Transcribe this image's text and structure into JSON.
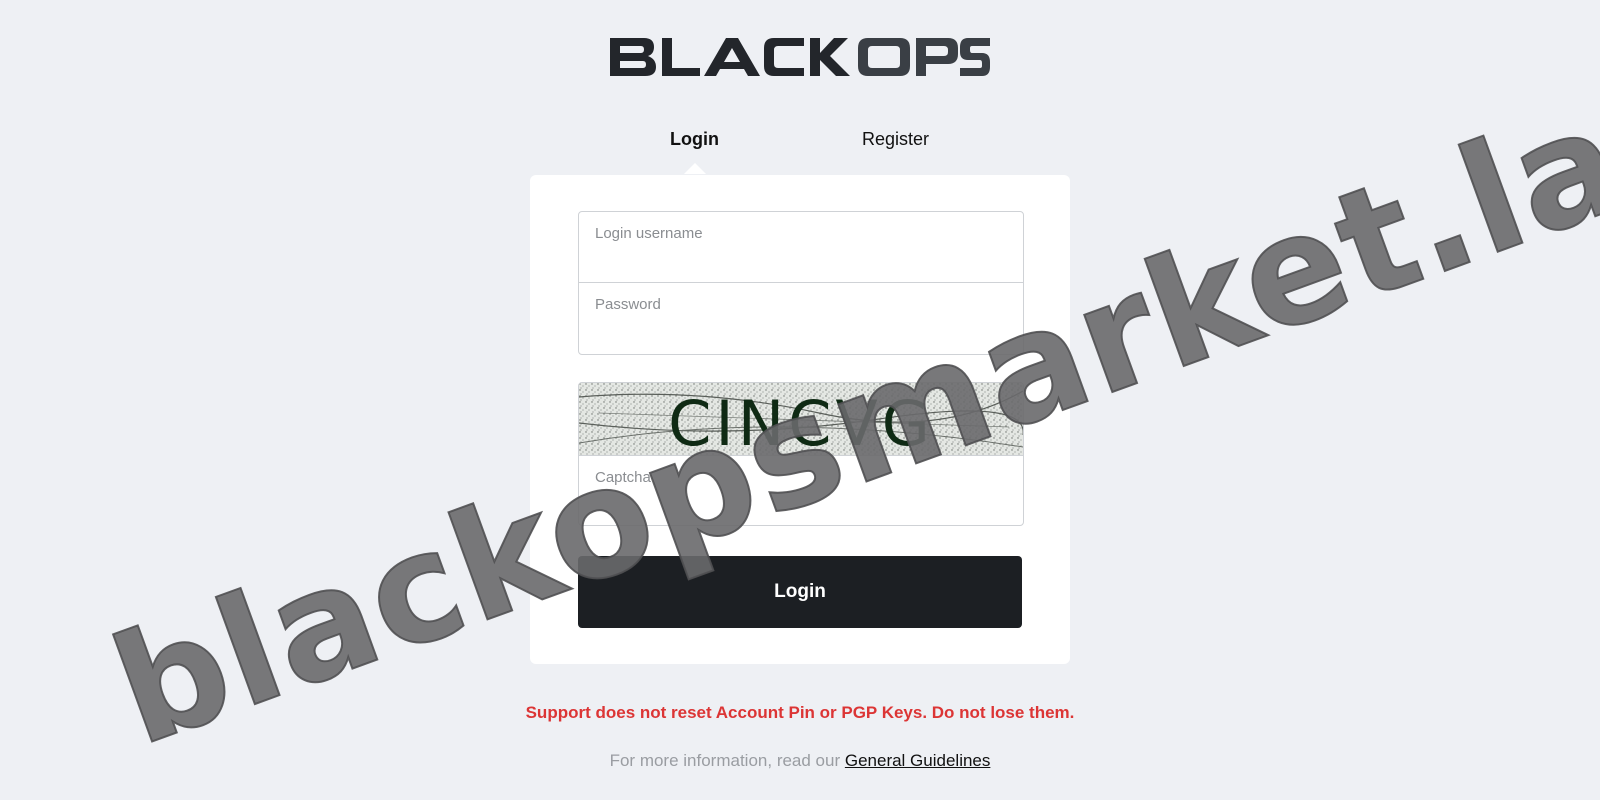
{
  "header": {
    "logo_text": "BLACK OPS",
    "logo_color_primary": "#23262b",
    "logo_color_secondary": "#3a3f45"
  },
  "tabs": [
    {
      "label": "Login",
      "active": true
    },
    {
      "label": "Register",
      "active": false
    }
  ],
  "form": {
    "username": {
      "label": "Login username",
      "value": ""
    },
    "password": {
      "label": "Password",
      "value": ""
    },
    "captcha": {
      "image_text": "CINCVG",
      "label": "Captcha",
      "value": ""
    },
    "submit_label": "Login"
  },
  "notices": {
    "warning": "Support does not reset Account Pin or PGP Keys. Do not lose them.",
    "info_prefix": "For more information, read our ",
    "guidelines_link": "General Guidelines"
  },
  "watermark": {
    "text": "blackopsmarket.lat"
  },
  "colors": {
    "background": "#eef0f4",
    "card": "#ffffff",
    "button": "#1c1f23",
    "warning": "#dc3535",
    "muted": "#9a9da2"
  }
}
